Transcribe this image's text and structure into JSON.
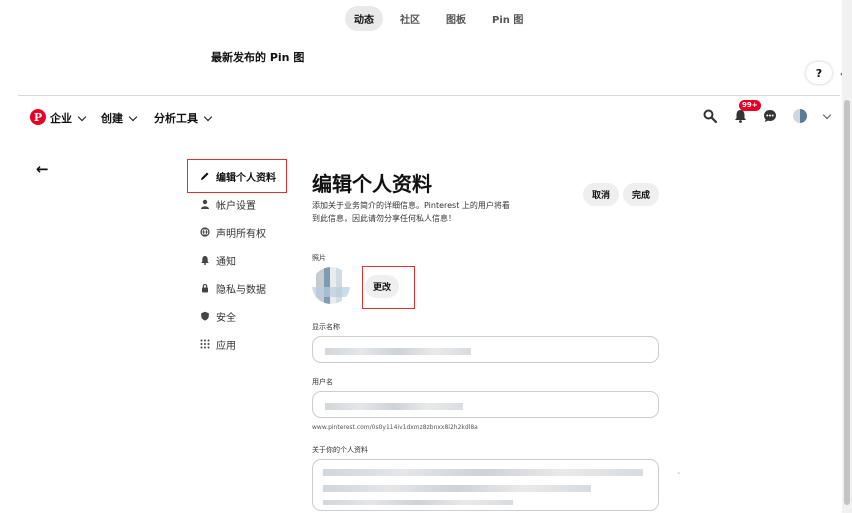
{
  "top_tabs": [
    {
      "label": "动态",
      "active": true
    },
    {
      "label": "社区",
      "active": false
    },
    {
      "label": "图板",
      "active": false
    },
    {
      "label": "Pin 图",
      "active": false
    }
  ],
  "section_title": "最新发布的 Pin 图",
  "help_label": "?",
  "return_glyph": "↵",
  "navbar": {
    "logo": "P",
    "menus": [
      "企业",
      "创建",
      "分析工具"
    ],
    "notification_count": "99+"
  },
  "back_arrow": "←",
  "sidebar": {
    "items": [
      {
        "label": "编辑个人资料",
        "icon": "pencil-icon",
        "active": true
      },
      {
        "label": "帐户设置",
        "icon": "person-icon",
        "active": false
      },
      {
        "label": "声明所有权",
        "icon": "globe-icon",
        "active": false
      },
      {
        "label": "通知",
        "icon": "bell-icon",
        "active": false
      },
      {
        "label": "隐私与数据",
        "icon": "lock-icon",
        "active": false
      },
      {
        "label": "安全",
        "icon": "shield-icon",
        "active": false
      },
      {
        "label": "应用",
        "icon": "grid-icon",
        "active": false
      }
    ]
  },
  "main": {
    "title": "编辑个人资料",
    "description": "添加关于业务简介的详细信息。Pinterest 上的用户将看到此信息，因此请勿分享任何私人信息！",
    "cancel_label": "取消",
    "done_label": "完成",
    "photo_label": "照片",
    "change_label": "更改",
    "display_name_label": "显示名称",
    "username_label": "用户名",
    "profile_url": "www.pinterest.com/0s0y114iv1dxmz8zbnxx8i2h2kdl8a",
    "about_label": "关于你的个人资料"
  },
  "colors": {
    "brand": "#e60023",
    "highlight_outline": "#e03030"
  }
}
